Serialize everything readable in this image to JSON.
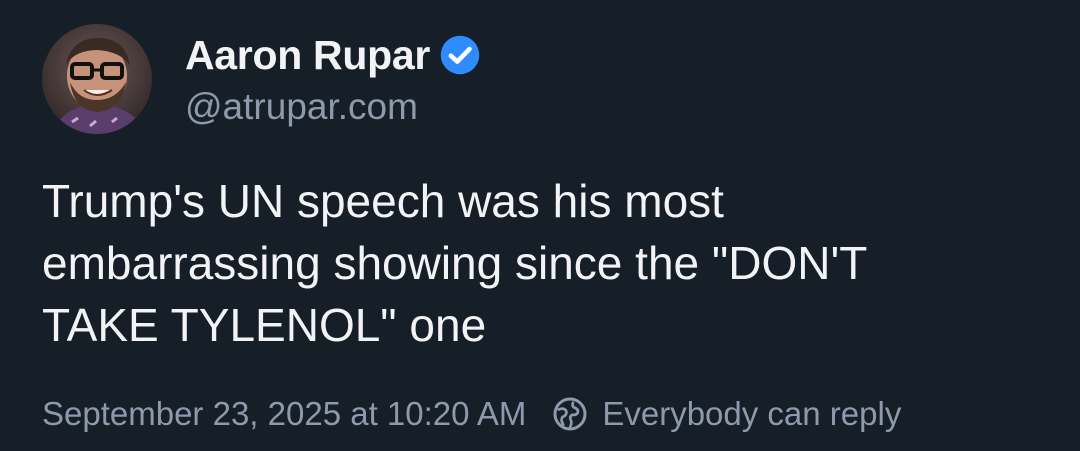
{
  "author": {
    "display_name": "Aaron Rupar",
    "handle": "@atrupar.com",
    "verified": true
  },
  "post": {
    "text_lines": [
      "Trump's UN speech was his most",
      "embarrassing showing since the \"DON'T",
      "TAKE TYLENOL\" one"
    ],
    "timestamp": "September 23, 2025 at 10:20 AM",
    "reply_setting": "Everybody can reply"
  },
  "icons": {
    "verified": "verified-badge-icon",
    "reply_setting": "globe-icon"
  },
  "colors": {
    "background": "#161e27",
    "text_primary": "#f1f3f5",
    "text_secondary": "#8d9aab",
    "verified_blue": "#2f8cff"
  }
}
